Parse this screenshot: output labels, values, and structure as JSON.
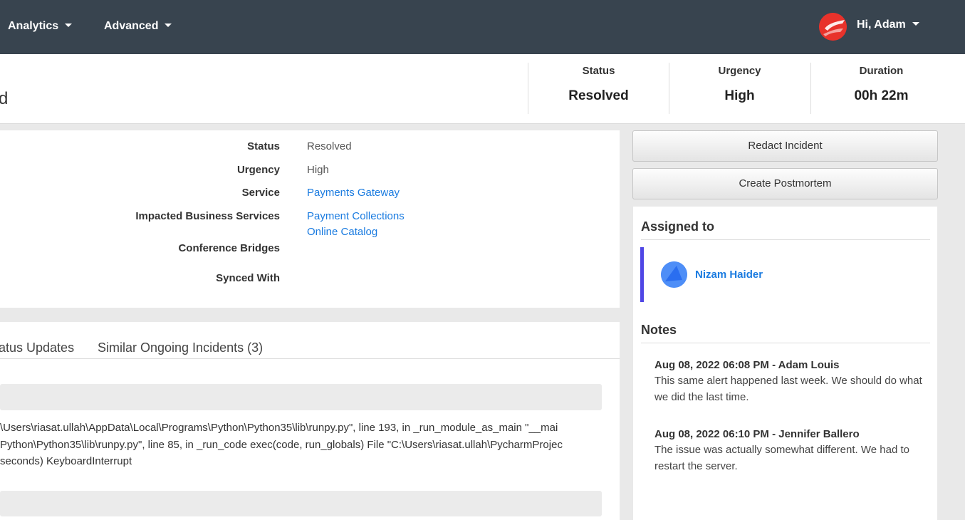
{
  "nav": {
    "analytics_label": "Analytics",
    "advanced_label": "Advanced",
    "user_greeting": "Hi, Adam",
    "brand_color": "#e8322b"
  },
  "header": {
    "title_fragment": "d",
    "stats": [
      {
        "label": "Status",
        "value": "Resolved"
      },
      {
        "label": "Urgency",
        "value": "High"
      },
      {
        "label": "Duration",
        "value": "00h 22m"
      }
    ]
  },
  "details": {
    "status_label": "Status",
    "status_value": "Resolved",
    "urgency_label": "Urgency",
    "urgency_value": "High",
    "service_label": "Service",
    "service_value": "Payments Gateway",
    "impacted_label": "Impacted Business Services",
    "impacted_values": [
      "Payment Collections",
      "Online Catalog"
    ],
    "bridges_label": "Conference Bridges",
    "synced_label": "Synced With"
  },
  "tabs": {
    "status_updates_label": "atus Updates",
    "similar_label": "Similar Ongoing Incidents (3)"
  },
  "log": {
    "lines": [
      "\\Users\\riasat.ullah\\AppData\\Local\\Programs\\Python\\Python35\\lib\\runpy.py\", line 193, in _run_module_as_main \"__mai",
      "Python\\Python35\\lib\\runpy.py\", line 85, in _run_code exec(code, run_globals) File \"C:\\Users\\riasat.ullah\\PycharmProjec",
      "seconds) KeyboardInterrupt"
    ]
  },
  "actions": {
    "redact_label": "Redact Incident",
    "postmortem_label": "Create Postmortem"
  },
  "assigned": {
    "title": "Assigned to",
    "name": "Nizam Haider",
    "accent_color": "#4f46e5"
  },
  "notes": {
    "title": "Notes",
    "items": [
      {
        "header": "Aug 08, 2022 06:08 PM - Adam Louis",
        "body": "This same alert happened last week. We should do what we did the last time."
      },
      {
        "header": "Aug 08, 2022 06:10 PM - Jennifer Ballero",
        "body": "The issue was actually somewhat different. We had to restart the server."
      }
    ]
  }
}
